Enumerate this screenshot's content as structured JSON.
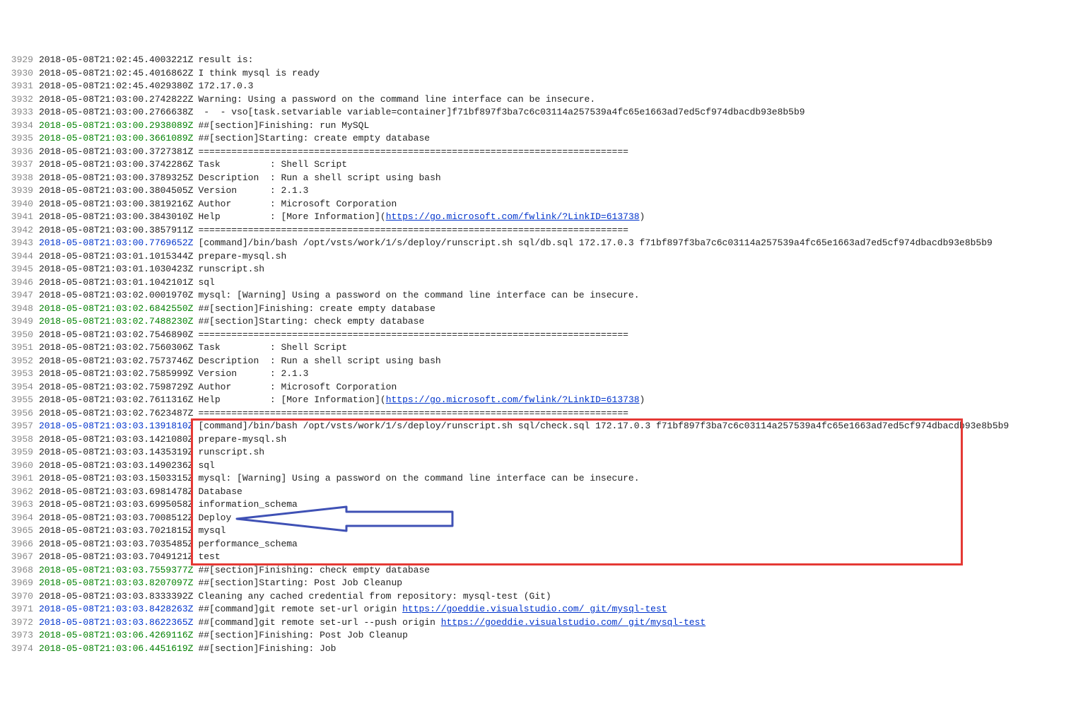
{
  "lines": [
    {
      "n": 3929,
      "ts": "2018-05-08T21:02:45.4003221Z",
      "cls": "",
      "msg": "result is:"
    },
    {
      "n": 3930,
      "ts": "2018-05-08T21:02:45.4016862Z",
      "cls": "",
      "msg": "I think mysql is ready"
    },
    {
      "n": 3931,
      "ts": "2018-05-08T21:02:45.4029380Z",
      "cls": "",
      "msg": "172.17.0.3"
    },
    {
      "n": 3932,
      "ts": "2018-05-08T21:03:00.2742822Z",
      "cls": "",
      "msg": "Warning: Using a password on the command line interface can be insecure."
    },
    {
      "n": 3933,
      "ts": "2018-05-08T21:03:00.2766638Z",
      "cls": "",
      "msg": " -  - vso[task.setvariable variable=container]f71bf897f3ba7c6c03114a257539a4fc65e1663ad7ed5cf974dbacdb93e8b5b9"
    },
    {
      "n": 3934,
      "ts": "2018-05-08T21:03:00.2938089Z",
      "cls": "green",
      "msg": "##[section]Finishing: run MySQL"
    },
    {
      "n": 3935,
      "ts": "2018-05-08T21:03:00.3661089Z",
      "cls": "green",
      "msg": "##[section]Starting: create empty database"
    },
    {
      "n": 3936,
      "ts": "2018-05-08T21:03:00.3727381Z",
      "cls": "",
      "msg": "=============================================================================="
    },
    {
      "n": 3937,
      "ts": "2018-05-08T21:03:00.3742286Z",
      "cls": "",
      "msg": "Task         : Shell Script"
    },
    {
      "n": 3938,
      "ts": "2018-05-08T21:03:00.3789325Z",
      "cls": "",
      "msg": "Description  : Run a shell script using bash"
    },
    {
      "n": 3939,
      "ts": "2018-05-08T21:03:00.3804505Z",
      "cls": "",
      "msg": "Version      : 2.1.3"
    },
    {
      "n": 3940,
      "ts": "2018-05-08T21:03:00.3819216Z",
      "cls": "",
      "msg": "Author       : Microsoft Corporation"
    },
    {
      "n": 3941,
      "ts": "2018-05-08T21:03:00.3843010Z",
      "cls": "",
      "msg": "Help         : [More Information](",
      "link": "https://go.microsoft.com/fwlink/?LinkID=613738",
      "after": ")"
    },
    {
      "n": 3942,
      "ts": "2018-05-08T21:03:00.3857911Z",
      "cls": "",
      "msg": "=============================================================================="
    },
    {
      "n": 3943,
      "ts": "2018-05-08T21:03:00.7769652Z",
      "cls": "blue",
      "msg": "[command]/bin/bash /opt/vsts/work/1/s/deploy/runscript.sh sql/db.sql 172.17.0.3 f71bf897f3ba7c6c03114a257539a4fc65e1663ad7ed5cf974dbacdb93e8b5b9"
    },
    {
      "n": 3944,
      "ts": "2018-05-08T21:03:01.1015344Z",
      "cls": "",
      "msg": "prepare-mysql.sh"
    },
    {
      "n": 3945,
      "ts": "2018-05-08T21:03:01.1030423Z",
      "cls": "",
      "msg": "runscript.sh"
    },
    {
      "n": 3946,
      "ts": "2018-05-08T21:03:01.1042101Z",
      "cls": "",
      "msg": "sql"
    },
    {
      "n": 3947,
      "ts": "2018-05-08T21:03:02.0001970Z",
      "cls": "",
      "msg": "mysql: [Warning] Using a password on the command line interface can be insecure."
    },
    {
      "n": 3948,
      "ts": "2018-05-08T21:03:02.6842550Z",
      "cls": "green",
      "msg": "##[section]Finishing: create empty database"
    },
    {
      "n": 3949,
      "ts": "2018-05-08T21:03:02.7488230Z",
      "cls": "green",
      "msg": "##[section]Starting: check empty database"
    },
    {
      "n": 3950,
      "ts": "2018-05-08T21:03:02.7546890Z",
      "cls": "",
      "msg": "=============================================================================="
    },
    {
      "n": 3951,
      "ts": "2018-05-08T21:03:02.7560306Z",
      "cls": "",
      "msg": "Task         : Shell Script"
    },
    {
      "n": 3952,
      "ts": "2018-05-08T21:03:02.7573746Z",
      "cls": "",
      "msg": "Description  : Run a shell script using bash"
    },
    {
      "n": 3953,
      "ts": "2018-05-08T21:03:02.7585999Z",
      "cls": "",
      "msg": "Version      : 2.1.3"
    },
    {
      "n": 3954,
      "ts": "2018-05-08T21:03:02.7598729Z",
      "cls": "",
      "msg": "Author       : Microsoft Corporation"
    },
    {
      "n": 3955,
      "ts": "2018-05-08T21:03:02.7611316Z",
      "cls": "",
      "msg": "Help         : [More Information](",
      "link": "https://go.microsoft.com/fwlink/?LinkID=613738",
      "after": ")"
    },
    {
      "n": 3956,
      "ts": "2018-05-08T21:03:02.7623487Z",
      "cls": "",
      "msg": "=============================================================================="
    },
    {
      "n": 3957,
      "ts": "2018-05-08T21:03:03.1391810Z",
      "cls": "blue",
      "msg": "[command]/bin/bash /opt/vsts/work/1/s/deploy/runscript.sh sql/check.sql 172.17.0.3 f71bf897f3ba7c6c03114a257539a4fc65e1663ad7ed5cf974dbacdb93e8b5b9"
    },
    {
      "n": 3958,
      "ts": "2018-05-08T21:03:03.1421080Z",
      "cls": "",
      "msg": "prepare-mysql.sh"
    },
    {
      "n": 3959,
      "ts": "2018-05-08T21:03:03.1435319Z",
      "cls": "",
      "msg": "runscript.sh"
    },
    {
      "n": 3960,
      "ts": "2018-05-08T21:03:03.1490236Z",
      "cls": "",
      "msg": "sql"
    },
    {
      "n": 3961,
      "ts": "2018-05-08T21:03:03.1503315Z",
      "cls": "",
      "msg": "mysql: [Warning] Using a password on the command line interface can be insecure."
    },
    {
      "n": 3962,
      "ts": "2018-05-08T21:03:03.6981478Z",
      "cls": "",
      "msg": "Database"
    },
    {
      "n": 3963,
      "ts": "2018-05-08T21:03:03.6995058Z",
      "cls": "",
      "msg": "information_schema"
    },
    {
      "n": 3964,
      "ts": "2018-05-08T21:03:03.7008512Z",
      "cls": "",
      "msg": "Deploy"
    },
    {
      "n": 3965,
      "ts": "2018-05-08T21:03:03.7021815Z",
      "cls": "",
      "msg": "mysql"
    },
    {
      "n": 3966,
      "ts": "2018-05-08T21:03:03.7035485Z",
      "cls": "",
      "msg": "performance_schema"
    },
    {
      "n": 3967,
      "ts": "2018-05-08T21:03:03.7049121Z",
      "cls": "",
      "msg": "test"
    },
    {
      "n": 3968,
      "ts": "2018-05-08T21:03:03.7559377Z",
      "cls": "green",
      "msg": "##[section]Finishing: check empty database"
    },
    {
      "n": 3969,
      "ts": "2018-05-08T21:03:03.8207097Z",
      "cls": "green",
      "msg": "##[section]Starting: Post Job Cleanup"
    },
    {
      "n": 3970,
      "ts": "2018-05-08T21:03:03.8333392Z",
      "cls": "",
      "msg": "Cleaning any cached credential from repository: mysql-test (Git)"
    },
    {
      "n": 3971,
      "ts": "2018-05-08T21:03:03.8428263Z",
      "cls": "blue",
      "msg": "##[command]git remote set-url origin ",
      "link": "https://goeddie.visualstudio.com/ git/mysql-test"
    },
    {
      "n": 3972,
      "ts": "2018-05-08T21:03:03.8622365Z",
      "cls": "blue",
      "msg": "##[command]git remote set-url --push origin ",
      "link": "https://goeddie.visualstudio.com/ git/mysql-test"
    },
    {
      "n": 3973,
      "ts": "2018-05-08T21:03:06.4269116Z",
      "cls": "green",
      "msg": "##[section]Finishing: Post Job Cleanup"
    },
    {
      "n": 3974,
      "ts": "2018-05-08T21:03:06.4451619Z",
      "cls": "green",
      "msg": "##[section]Finishing: Job"
    }
  ],
  "highlight": {
    "redbox": {
      "top_line_idx": 28,
      "bottom_line_idx": 38
    },
    "arrow_line_idx": 35
  }
}
